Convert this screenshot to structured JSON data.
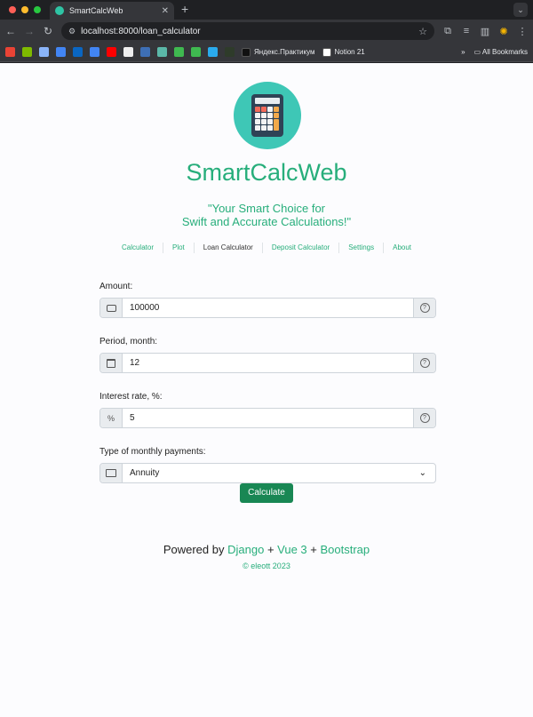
{
  "browser": {
    "tab_title": "SmartCalcWeb",
    "url": "localhost:8000/loan_calculator",
    "bookmarks": [
      {
        "icon": "gmail-icon",
        "color": "#ea4335"
      },
      {
        "icon": "microsoft-icon",
        "color": "#7fba00"
      },
      {
        "icon": "globe-icon",
        "color": "#8ab4f8"
      },
      {
        "icon": "calendar-icon",
        "color": "#4285f4"
      },
      {
        "icon": "onedrive-icon",
        "color": "#0a66c2"
      },
      {
        "icon": "translate-icon",
        "color": "#4285f4"
      },
      {
        "icon": "youtube-icon",
        "color": "#ff0000"
      },
      {
        "icon": "bookmark-b-icon",
        "color": "#eeeeee"
      },
      {
        "icon": "k-icon",
        "color": "#3e6fb5"
      },
      {
        "icon": "search-icon",
        "color": "#5bb8a8"
      },
      {
        "icon": "terminal-icon",
        "color": "#3fb950"
      },
      {
        "icon": "twentyone-icon",
        "color": "#3fb950"
      },
      {
        "icon": "telegram-icon",
        "color": "#2aabee"
      },
      {
        "icon": "dark-app-icon",
        "color": "#2e3b2a"
      }
    ],
    "bookmark_practicum": "Яндекс.Практикум",
    "bookmark_notion": "Notion 21",
    "all_bookmarks": "All Bookmarks"
  },
  "app": {
    "title": "SmartCalcWeb",
    "tagline_line1": "\"Your Smart Choice for",
    "tagline_line2": "Swift and Accurate Calculations!\""
  },
  "nav": [
    {
      "label": "Calculator",
      "active": false
    },
    {
      "label": "Plot",
      "active": false
    },
    {
      "label": "Loan Calculator",
      "active": true
    },
    {
      "label": "Deposit Calculator",
      "active": false
    },
    {
      "label": "Settings",
      "active": false
    },
    {
      "label": "About",
      "active": false
    }
  ],
  "form": {
    "amount_label": "Amount:",
    "amount_value": "100000",
    "period_label": "Period, month:",
    "period_value": "12",
    "rate_label": "Interest rate, %:",
    "rate_value": "5",
    "rate_symbol": "%",
    "type_label": "Type of monthly payments:",
    "type_value": "Annuity",
    "help_symbol": "?",
    "submit_label": "Calculate"
  },
  "footer": {
    "powered_by": "Powered by",
    "django": "Django",
    "plus": "+",
    "vue": "Vue 3",
    "bootstrap": "Bootstrap",
    "copyright": "© eleott 2023"
  },
  "colors": {
    "accent": "#27ae7b",
    "button": "#198754",
    "logo_bg": "#3ec7b6"
  }
}
